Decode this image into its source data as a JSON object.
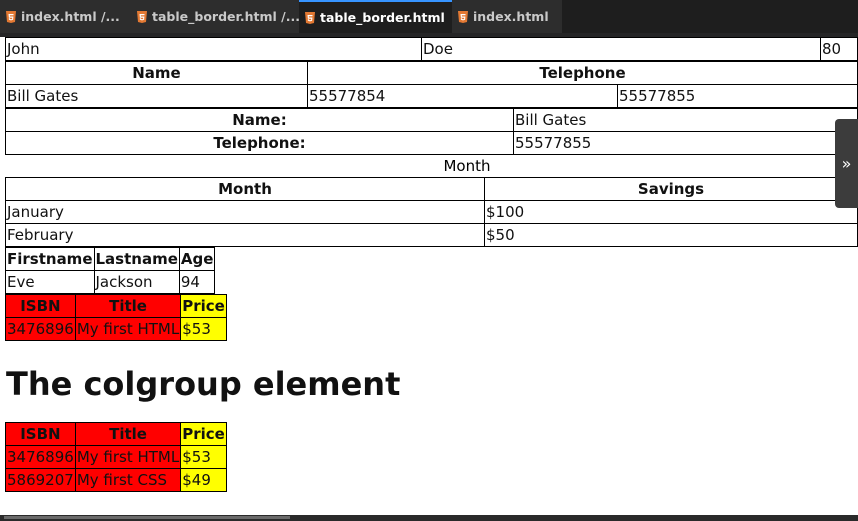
{
  "tabs": [
    {
      "label": "index.html",
      "suffix": "/...",
      "active": false
    },
    {
      "label": "table_border.html",
      "suffix": "/...",
      "active": false
    },
    {
      "label": "table_border.html",
      "suffix": "",
      "active": true,
      "close": "×"
    },
    {
      "label": "index.html",
      "suffix": "",
      "active": false
    }
  ],
  "colors": {
    "html_icon": "#e37933",
    "red_col": "#ff0000",
    "yellow_col": "#ffff00"
  },
  "table1": {
    "row": [
      "John",
      "Doe",
      "80"
    ]
  },
  "table2": {
    "headers": [
      "Name",
      "Telephone"
    ],
    "row": [
      "Bill Gates",
      "55577854",
      "55577855"
    ]
  },
  "table3": {
    "rows": [
      {
        "th": "Name:",
        "td": "Bill Gates"
      },
      {
        "th": "Telephone:",
        "td": "55577855"
      }
    ]
  },
  "table4": {
    "caption": "Month",
    "headers": [
      "Month",
      "Savings"
    ],
    "rows": [
      [
        "January",
        "$100"
      ],
      [
        "February",
        "$50"
      ]
    ]
  },
  "table5": {
    "headers": [
      "Firstname",
      "Lastname",
      "Age"
    ],
    "row": [
      "Eve",
      "Jackson",
      "94"
    ]
  },
  "table6": {
    "headers": [
      "ISBN",
      "Title",
      "Price"
    ],
    "row": [
      "3476896",
      "My first HTML",
      "$53"
    ]
  },
  "heading": "The colgroup element",
  "table7": {
    "headers": [
      "ISBN",
      "Title",
      "Price"
    ],
    "rows": [
      [
        "3476896",
        "My first HTML",
        "$53"
      ],
      [
        "5869207",
        "My first CSS",
        "$49"
      ]
    ]
  },
  "side_button": {
    "glyph": "»",
    "icon": "double-chevron-right-icon"
  }
}
